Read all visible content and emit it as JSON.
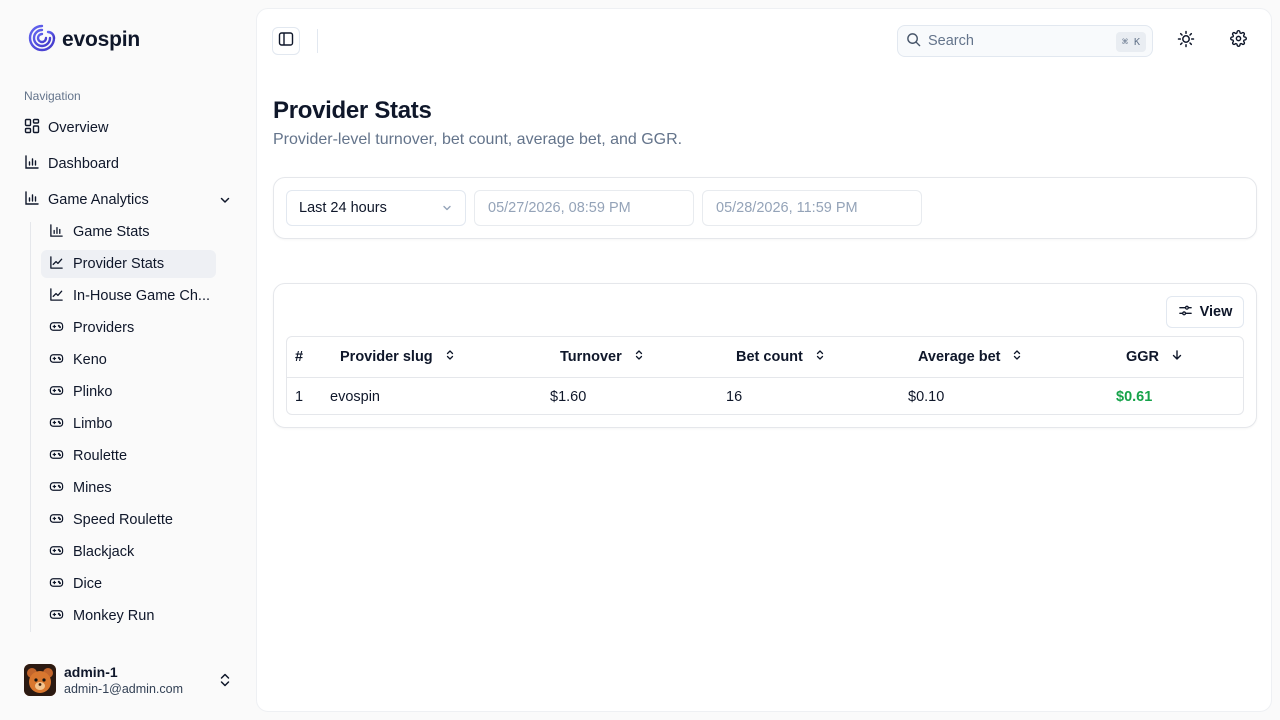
{
  "brand": {
    "name": "evospin"
  },
  "nav": {
    "heading": "Navigation",
    "items": [
      {
        "label": "Overview",
        "icon": "layout-grid-icon"
      },
      {
        "label": "Dashboard",
        "icon": "bar-chart-icon"
      },
      {
        "label": "Game Analytics",
        "icon": "bar-chart-icon",
        "expanded": true
      }
    ],
    "sub_items": [
      {
        "label": "Game Stats",
        "icon": "bar-chart-icon"
      },
      {
        "label": "Provider Stats",
        "icon": "line-chart-icon",
        "active": true
      },
      {
        "label": "In-House Game Ch...",
        "icon": "line-chart-icon"
      },
      {
        "label": "Providers",
        "icon": "gamepad-icon"
      },
      {
        "label": "Keno",
        "icon": "gamepad-icon"
      },
      {
        "label": "Plinko",
        "icon": "gamepad-icon"
      },
      {
        "label": "Limbo",
        "icon": "gamepad-icon"
      },
      {
        "label": "Roulette",
        "icon": "gamepad-icon"
      },
      {
        "label": "Mines",
        "icon": "gamepad-icon"
      },
      {
        "label": "Speed Roulette",
        "icon": "gamepad-icon"
      },
      {
        "label": "Blackjack",
        "icon": "gamepad-icon"
      },
      {
        "label": "Dice",
        "icon": "gamepad-icon"
      },
      {
        "label": "Monkey Run",
        "icon": "gamepad-icon"
      }
    ]
  },
  "user": {
    "name": "admin-1",
    "email": "admin-1@admin.com"
  },
  "header": {
    "search_placeholder": "Search",
    "search_shortcut": "⌘ K"
  },
  "page": {
    "title": "Provider Stats",
    "subtitle": "Provider-level turnover, bet count, average bet, and GGR."
  },
  "filters": {
    "range_label": "Last 24 hours",
    "from_date": "05/27/2026, 08:59 PM",
    "to_date": "05/28/2026, 11:59 PM"
  },
  "table": {
    "view_label": "View",
    "columns": [
      "#",
      "Provider slug",
      "Turnover",
      "Bet count",
      "Average bet",
      "GGR"
    ],
    "sort": {
      "column": "GGR",
      "direction": "desc"
    },
    "rows": [
      [
        "1",
        "evospin",
        "$1.60",
        "16",
        "$0.10",
        "$0.61"
      ]
    ]
  },
  "colors": {
    "accent": "#4f46e5",
    "positive": "#16a34a",
    "muted": "#64748b"
  }
}
